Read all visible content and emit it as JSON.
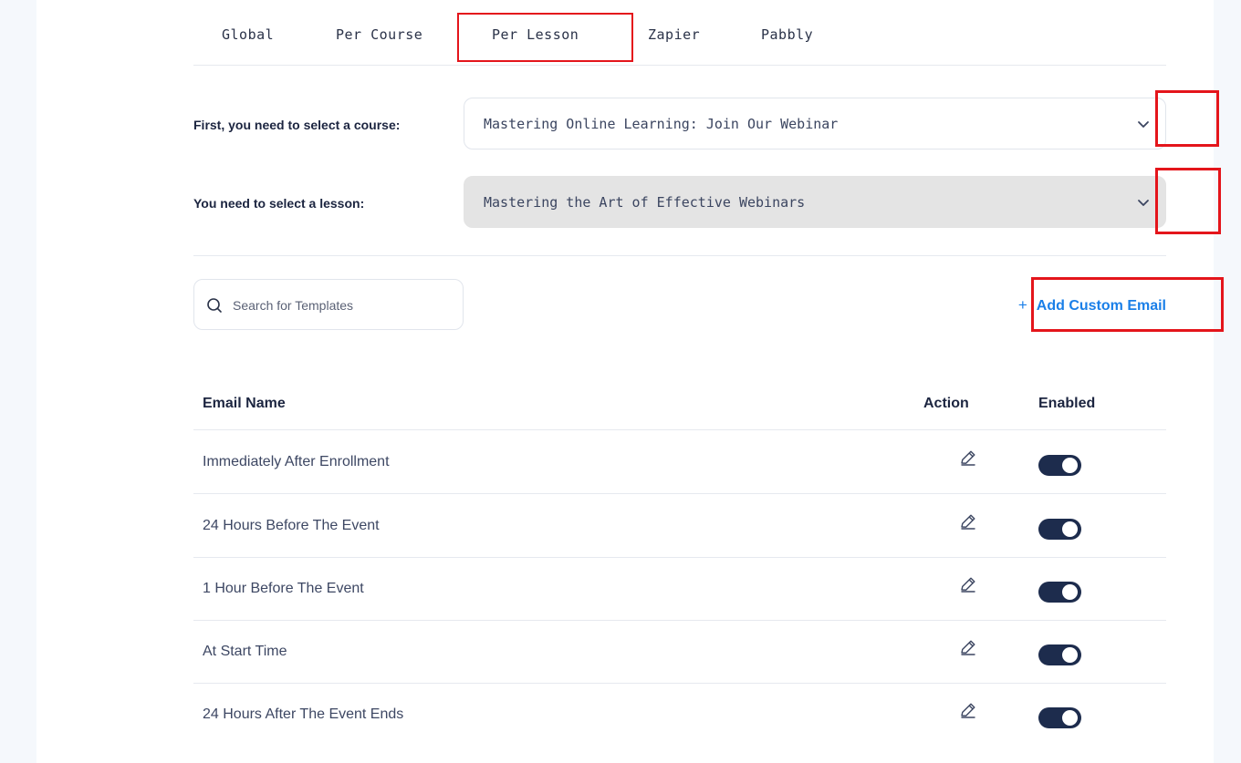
{
  "tabs": [
    {
      "label": "Global"
    },
    {
      "label": "Per Course"
    },
    {
      "label": "Per Lesson"
    },
    {
      "label": "Zapier"
    },
    {
      "label": "Pabbly"
    }
  ],
  "active_tab": "Per Lesson",
  "course_select": {
    "label": "First, you need to select a course:",
    "value": "Mastering Online Learning: Join Our Webinar"
  },
  "lesson_select": {
    "label": "You need to select a lesson:",
    "value": "Mastering the Art of Effective Webinars"
  },
  "search": {
    "placeholder": "Search for Templates",
    "icon": "search-icon"
  },
  "add_custom_email": {
    "icon": "+",
    "label": "Add Custom Email"
  },
  "table": {
    "headers": {
      "name": "Email Name",
      "action": "Action",
      "enabled": "Enabled"
    },
    "rows": [
      {
        "name": "Immediately After Enrollment",
        "enabled": true
      },
      {
        "name": "24 Hours Before The Event",
        "enabled": true
      },
      {
        "name": "1 Hour Before The Event",
        "enabled": true
      },
      {
        "name": "At Start Time",
        "enabled": true
      },
      {
        "name": "24 Hours After The Event Ends",
        "enabled": true
      }
    ]
  },
  "colors": {
    "accent_blue": "#1a7fe8",
    "toggle_on": "#1d2c4d",
    "highlight_red": "#e4151b",
    "text_dark": "#1c2540"
  }
}
